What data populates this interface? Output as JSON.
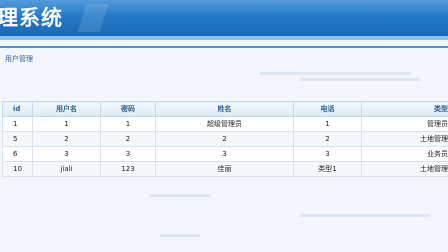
{
  "app": {
    "title": "理系统"
  },
  "breadcrumb": {
    "label": "用户管理"
  },
  "table": {
    "columns": [
      "id",
      "用户名",
      "密码",
      "姓名",
      "电话",
      "类型"
    ],
    "rows": [
      [
        "1",
        "1",
        "1",
        "超级管理员",
        "1",
        "管理员"
      ],
      [
        "5",
        "2",
        "2",
        "2",
        "2",
        "土地管理"
      ],
      [
        "6",
        "3",
        "3",
        "3",
        "3",
        "业务员"
      ],
      [
        "10",
        "jiali",
        "123",
        "佳丽",
        "类型1",
        "土地管理"
      ]
    ]
  },
  "colors": {
    "banner": "#1f74c4",
    "header_text": "#2f5e92",
    "grid_border": "#c5d8ea"
  }
}
